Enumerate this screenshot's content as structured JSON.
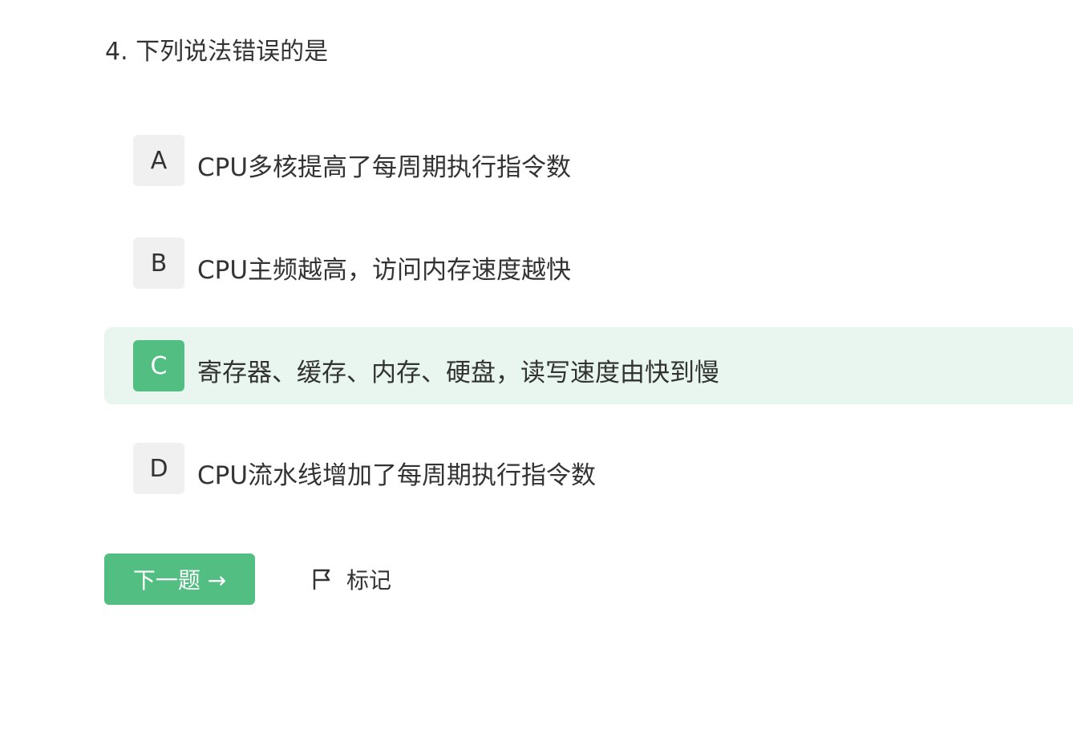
{
  "question": {
    "title": "4. 下列说法错误的是"
  },
  "options": [
    {
      "letter": "A",
      "text": "CPU多核提高了每周期执行指令数",
      "selected": false
    },
    {
      "letter": "B",
      "text": "CPU主频越高，访问内存速度越快",
      "selected": false
    },
    {
      "letter": "C",
      "text": "寄存器、缓存、内存、硬盘，读写速度由快到慢",
      "selected": true
    },
    {
      "letter": "D",
      "text": "CPU流水线增加了每周期执行指令数",
      "selected": false
    }
  ],
  "actions": {
    "next_label": "下一题 →",
    "mark_label": "标记",
    "mark_icon": "flag-icon"
  },
  "colors": {
    "accent": "#52be82",
    "selected_background": "#e8f6ef",
    "letter_background": "#f0f0f0",
    "text": "#333333"
  }
}
